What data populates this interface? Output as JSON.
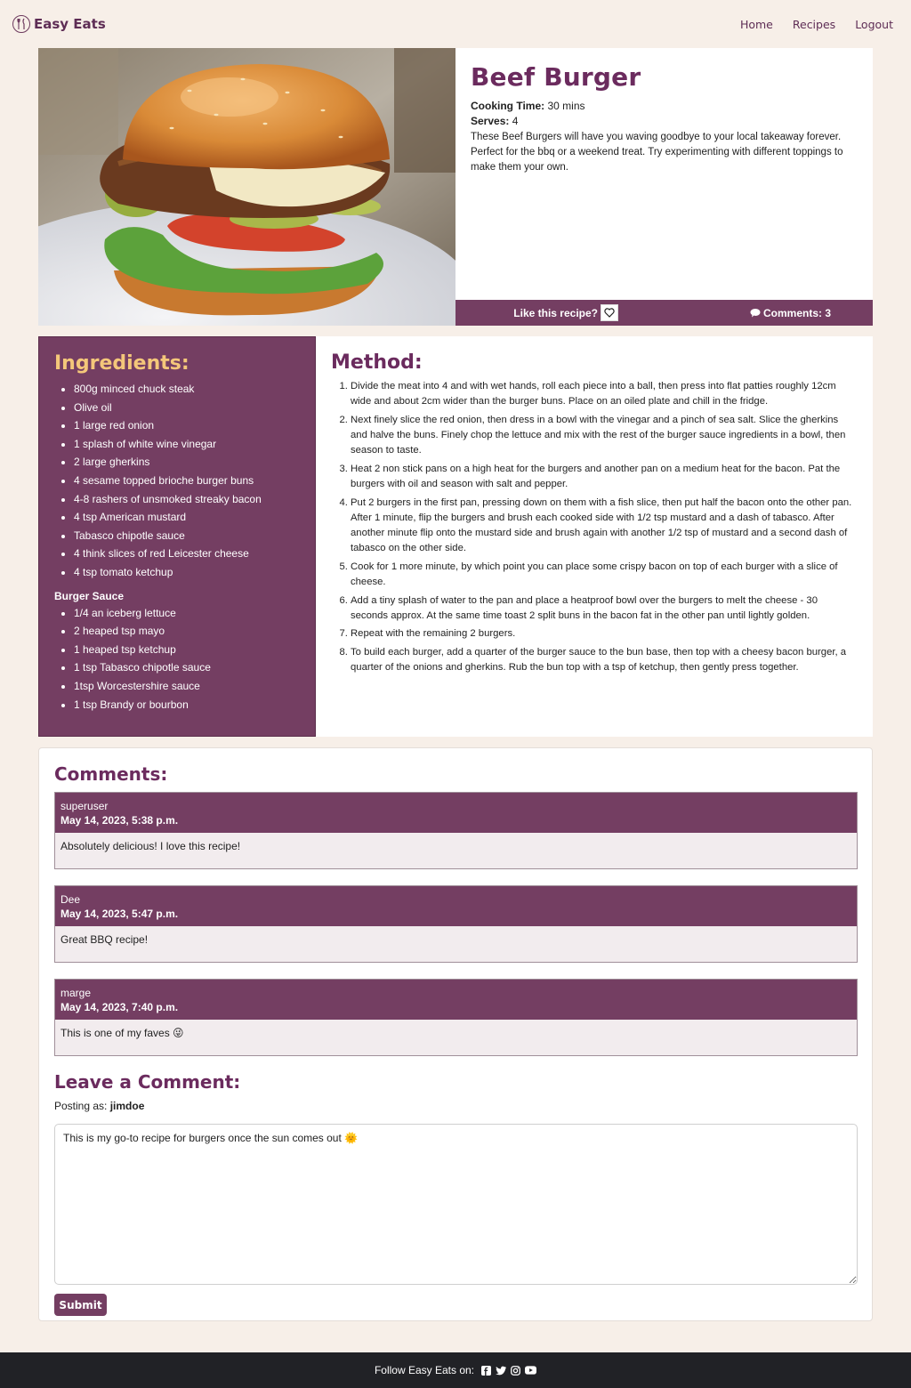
{
  "nav": {
    "brand": "Easy Eats",
    "links": [
      "Home",
      "Recipes",
      "Logout"
    ]
  },
  "recipe": {
    "title": "Beef Burger",
    "cooking_time_label": "Cooking Time:",
    "cooking_time": "30 mins",
    "serves_label": "Serves:",
    "serves": "4",
    "description": "These Beef Burgers will have you waving goodbye to your local takeaway forever. Perfect for the bbq or a weekend treat. Try experimenting with different toppings to make them your own.",
    "like_label": "Like this recipe?",
    "comments_label": "Comments: 3"
  },
  "ingredients": {
    "title": "Ingredients:",
    "items": [
      "800g minced chuck steak",
      "Olive oil",
      "1 large red onion",
      "1 splash of white wine vinegar",
      "2 large gherkins",
      "4 sesame topped brioche burger buns",
      "4-8 rashers of unsmoked streaky bacon",
      "4 tsp American mustard",
      "Tabasco chipotle sauce",
      "4 think slices of red Leicester cheese",
      "4 tsp tomato ketchup"
    ],
    "sauce_title": "Burger Sauce",
    "sauce_items": [
      "1/4 an iceberg lettuce",
      "2 heaped tsp mayo",
      "1 heaped tsp ketchup",
      "1 tsp Tabasco chipotle sauce",
      "1tsp Worcestershire sauce",
      "1 tsp Brandy or bourbon"
    ]
  },
  "method": {
    "title": "Method:",
    "steps": [
      "Divide the meat into 4 and with wet hands, roll each piece into a ball, then press into flat patties roughly 12cm wide and about 2cm wider than the burger buns. Place on an oiled plate and chill in the fridge.",
      "Next finely slice the red onion, then dress in a bowl with the vinegar and a pinch of sea salt. Slice the gherkins and halve the buns. Finely chop the lettuce and mix with the rest of the burger sauce ingredients in a bowl, then season to taste.",
      "Heat 2 non stick pans on a high heat for the burgers and another pan on a medium heat for the bacon. Pat the burgers with oil and season with salt and pepper.",
      "Put 2 burgers in the first pan, pressing down on them with a fish slice, then put half the bacon onto the other pan. After 1 minute, flip the burgers and brush each cooked side with 1/2 tsp mustard and a dash of tabasco. After another minute flip onto the mustard side and brush again with another 1/2 tsp of mustard and a second dash of tabasco on the other side.",
      "Cook for 1 more minute, by which point you can place some crispy bacon on top of each burger with a slice of cheese.",
      "Add a tiny splash of water to the pan and place a heatproof bowl over the burgers to melt the cheese - 30 seconds approx. At the same time toast 2 split buns in the bacon fat in the other pan until lightly golden.",
      "Repeat with the remaining 2 burgers.",
      "To build each burger, add a quarter of the burger sauce to the bun base, then top with a cheesy bacon burger, a quarter of the onions and gherkins. Rub the bun top with a tsp of ketchup, then gently press together."
    ]
  },
  "comments": {
    "title": "Comments:",
    "items": [
      {
        "author": "superuser",
        "date": "May 14, 2023, 5:38 p.m.",
        "body": "Absolutely delicious! I love this recipe!"
      },
      {
        "author": "Dee",
        "date": "May 14, 2023, 5:47 p.m.",
        "body": "Great BBQ recipe!"
      },
      {
        "author": "marge",
        "date": "May 14, 2023, 7:40 p.m.",
        "body": "This is one of my faves 😜"
      }
    ]
  },
  "leave_comment": {
    "title": "Leave a Comment:",
    "posting_as_label": "Posting as:",
    "username": "jimdoe",
    "value": "This is my go-to recipe for burgers once the sun comes out 🌞",
    "submit_label": "Submit"
  },
  "footer": {
    "text": "Follow Easy Eats on:",
    "icons": [
      "facebook-icon",
      "twitter-icon",
      "instagram-icon",
      "youtube-icon"
    ]
  },
  "colors": {
    "background": "#f7efe8",
    "plum": "#743e62",
    "title_plum": "#6b2b5e",
    "ingredients_heading": "#f4c77a",
    "footer": "#212226"
  }
}
